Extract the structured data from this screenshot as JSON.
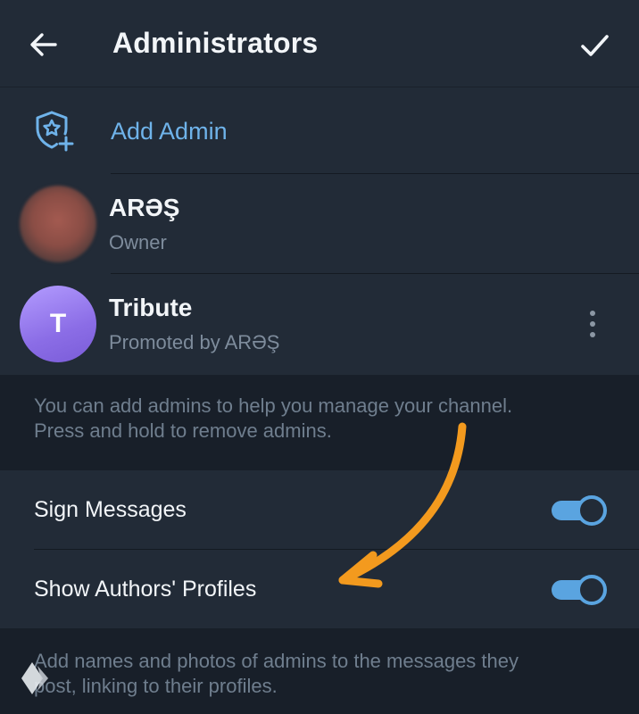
{
  "header": {
    "title": "Administrators",
    "back_icon": "arrow-left-icon",
    "confirm_icon": "check-icon"
  },
  "add_admin": {
    "label": "Add Admin",
    "icon": "shield-star-add-icon"
  },
  "admins": [
    {
      "name": "ARƏŞ",
      "role": "Owner",
      "avatar_letter": ""
    },
    {
      "name": "Tribute",
      "role": "Promoted by ARƏŞ",
      "avatar_letter": "T"
    }
  ],
  "admins_hint": {
    "line1": "You can add admins to help you manage your channel.",
    "line2": "Press and hold to remove admins."
  },
  "settings": [
    {
      "label": "Sign Messages",
      "enabled": true
    },
    {
      "label": "Show Authors' Profiles",
      "enabled": true
    }
  ],
  "settings_hint": {
    "line1": "Add names and photos of admins to the messages they",
    "line2": "post, linking to their profiles."
  },
  "colors": {
    "background": "#181f29",
    "card": "#222b37",
    "accent": "#6fb3ea",
    "toggle_on": "#5aa4e0",
    "avatar_purple": "#8b6de6",
    "annotation_arrow": "#f39a1e"
  }
}
